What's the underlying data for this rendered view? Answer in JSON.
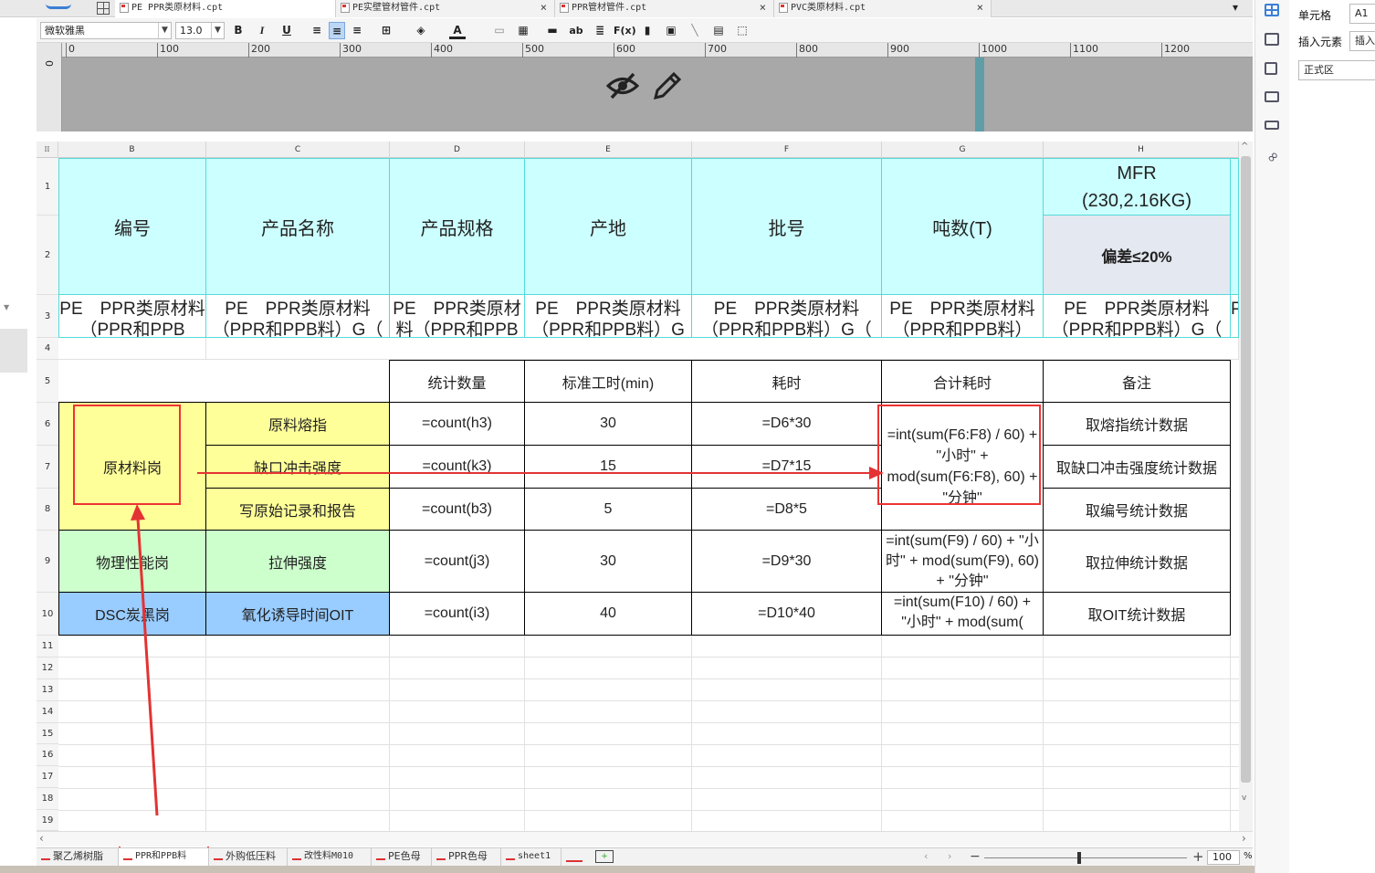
{
  "file_tabs": [
    {
      "label": "PE PPR类原材料.cpt",
      "active": true
    },
    {
      "label": "PE实壁管材管件.cpt",
      "active": false
    },
    {
      "label": "PPR管材管件.cpt",
      "active": false
    },
    {
      "label": "PVC类原材料.cpt",
      "active": false
    }
  ],
  "toolbar": {
    "font_name": "微软雅黑",
    "font_size": "13.0",
    "bold": "B",
    "italic": "I",
    "underline": "U"
  },
  "ruler_ticks": [
    "0",
    "100",
    "200",
    "300",
    "400",
    "500",
    "600",
    "700",
    "800",
    "900",
    "1000",
    "1100",
    "1200"
  ],
  "ruler_vertical_label": "0",
  "properties": {
    "cell_label": "单元格",
    "cell_value": "A1",
    "insert_element_label": "插入元素",
    "insert_value": "插入",
    "region_value": "正式区"
  },
  "columns": [
    "B",
    "C",
    "D",
    "E",
    "F",
    "G",
    "H"
  ],
  "rows": {
    "r1": "1",
    "r2": "2",
    "numbers": [
      "3",
      "4",
      "5",
      "6",
      "7",
      "8",
      "9",
      "10",
      "11",
      "12",
      "13",
      "14",
      "15",
      "16",
      "17",
      "18",
      "19"
    ]
  },
  "header": {
    "b": "编号",
    "c": "产品名称",
    "d": "产品规格",
    "e": "产地",
    "f": "批号",
    "g": "吨数(T)",
    "h_top": "MFR",
    "h_top2": "(230,2.16KG)",
    "h_bottom": "偏差≤20%"
  },
  "row3": {
    "b": "PE　PPR类原材料（PPR和PPB",
    "c": "PE　PPR类原材料（PPR和PPB料）G（",
    "d": "PE　PPR类原材料（PPR和PPB",
    "e": "PE　PPR类原材料（PPR和PPB料）G（",
    "f": "PE　PPR类原材料（PPR和PPB料）G（",
    "g": "PE　PPR类原材料（PPR和PPB料）",
    "h": "PE　PPR类原材料（PPR和PPB料）G（",
    "i": "P"
  },
  "table": {
    "head": {
      "d": "统计数量",
      "e": "标准工时(min)",
      "f": "耗时",
      "g": "合计耗时",
      "h": "备注"
    },
    "group_raw": "原材料岗",
    "rows": [
      {
        "c": "原料熔指",
        "d": "=count(h3)",
        "e": "30",
        "f": "=D6*30",
        "h": "取熔指统计数据"
      },
      {
        "c": "缺口冲击强度",
        "d": "=count(k3)",
        "e": "15",
        "f": "=D7*15",
        "h": "取缺口冲击强度统计数据"
      },
      {
        "c": "写原始记录和报告",
        "d": "=count(b3)",
        "e": "5",
        "f": "=D8*5",
        "h": "取编号统计数据"
      },
      {
        "b": "物理性能岗",
        "c": "拉伸强度",
        "d": "=count(j3)",
        "e": "30",
        "f": "=D9*30",
        "h": "取拉伸统计数据"
      },
      {
        "b": "DSC炭黑岗",
        "c": "氧化诱导时间OIT",
        "d": "=count(i3)",
        "e": "40",
        "f": "=D10*40",
        "h": "取OIT统计数据"
      }
    ],
    "g_raw": "=int(sum(F6:F8) / 60) + \"小时\" + mod(sum(F6:F8), 60) + \"分钟\"",
    "g_phys": "=int(sum(F9) / 60) + \"小时\" + mod(sum(F9), 60) + \"分钟\"",
    "g_dsc": "=int(sum(F10) / 60) + \"小时\" + mod(sum("
  },
  "sheet_tabs": [
    "聚乙烯树脂",
    "PPR和PPB料",
    "外购低压料",
    "改性料M010",
    "PE色母",
    "PPR色母",
    "sheet1"
  ],
  "active_sheet_index": 1,
  "zoom": "100",
  "zoom_unit": "%",
  "zoom_minus": "−",
  "zoom_plus": "+",
  "annotation_color": "#e33333"
}
